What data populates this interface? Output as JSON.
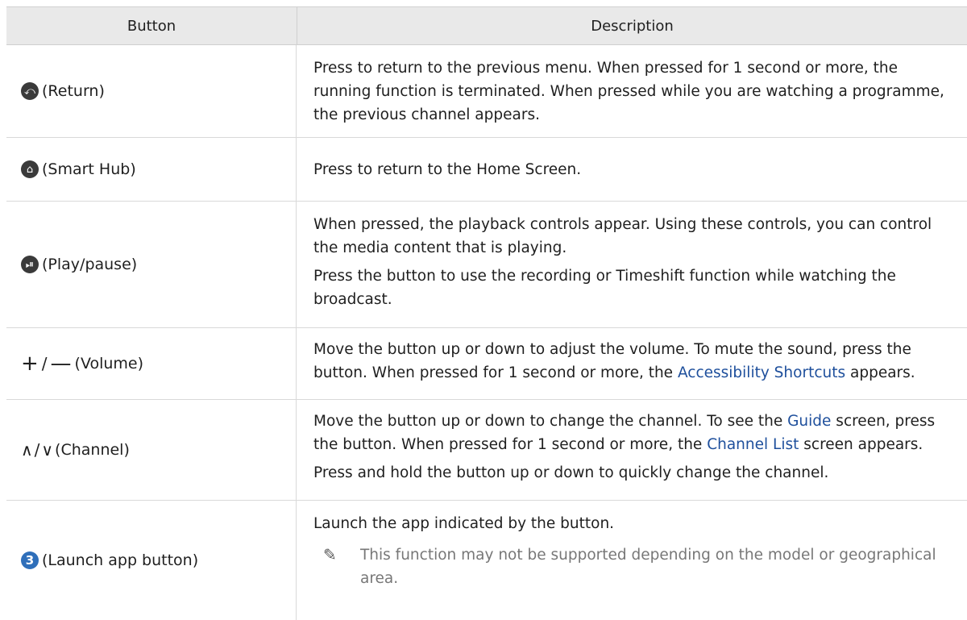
{
  "header": {
    "button": "Button",
    "description": "Description"
  },
  "rows": [
    {
      "button_label": "(Return)",
      "icon": "return-icon",
      "desc": [
        "Press to return to the previous menu. When pressed for 1 second or more, the running function is terminated. When pressed while you are watching a programme, the previous channel appears."
      ]
    },
    {
      "button_label": "(Smart Hub)",
      "icon": "home-icon",
      "desc": [
        "Press to return to the Home Screen."
      ]
    },
    {
      "button_label": "(Play/pause)",
      "icon": "play-pause-icon",
      "desc": [
        "When pressed, the playback controls appear. Using these controls, you can control the media content that is playing.",
        "Press the button to use the recording or Timeshift function while watching the broadcast."
      ]
    },
    {
      "button_label": "(Volume)",
      "icon": "volume-plus-minus-icon",
      "desc_parts": {
        "before": "Move the button up or down to adjust the volume. To mute the sound, press the button. When pressed for 1 second or more, the ",
        "link": "Accessibility Shortcuts",
        "after": " appears."
      }
    },
    {
      "button_label": "(Channel)",
      "icon": "channel-up-down-icon",
      "desc_parts": {
        "p1_before": "Move the button up or down to change the channel. To see the ",
        "p1_link1": "Guide",
        "p1_mid": " screen, press the button. When pressed for 1 second or more, the ",
        "p1_link2": "Channel List",
        "p1_after": " screen appears.",
        "p2": "Press and hold the button up or down to quickly change the channel."
      }
    },
    {
      "button_label": "(Launch app button)",
      "icon": "launch-app-3-icon",
      "icon_text": "3",
      "desc": [
        "Launch the app indicated by the button."
      ],
      "note": "This function may not be supported depending on the model or geographical area."
    }
  ],
  "symbols": {
    "plus": "+",
    "slash": "/",
    "minus": "—",
    "up": "∧",
    "down": "∨"
  },
  "colors": {
    "link": "#1e4f9c",
    "header_bg": "#e9e9e9",
    "launch_icon": "#2f6fba"
  }
}
